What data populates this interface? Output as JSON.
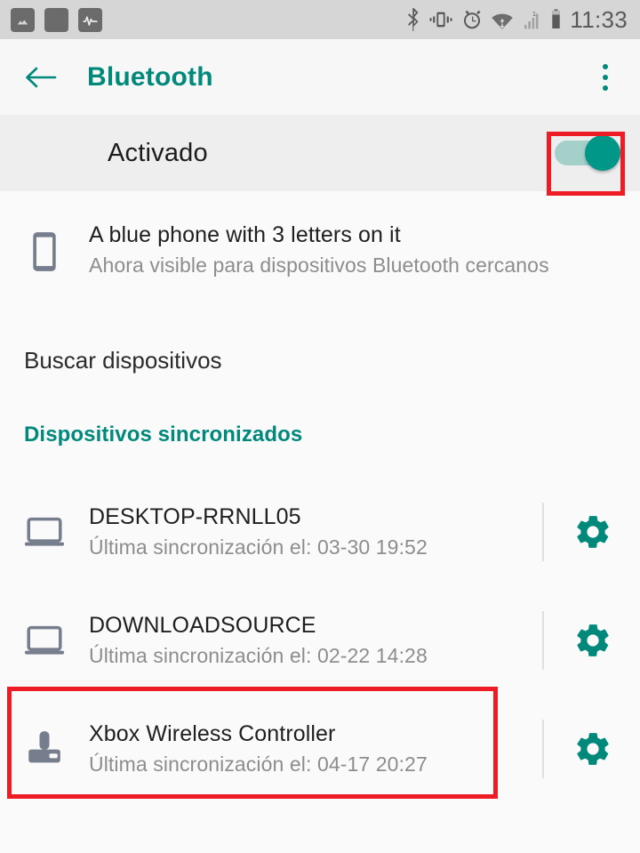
{
  "status_bar": {
    "time": "11:33",
    "notification_icons": [
      "image-icon",
      "blank-square-icon",
      "pulse-icon"
    ],
    "system_icons": [
      "bluetooth-icon",
      "vibrate-icon",
      "alarm-icon",
      "wifi-icon",
      "signal-icon",
      "battery-icon"
    ]
  },
  "app_bar": {
    "title": "Bluetooth",
    "back_icon": "arrow-left-icon",
    "overflow_icon": "more-vertical-icon",
    "accent_color": "#00897b"
  },
  "toggle": {
    "label": "Activado",
    "state": "on",
    "track_color": "#a5cfc9",
    "thumb_color": "#009688",
    "highlight_color": "#ee1c25"
  },
  "self_device": {
    "icon": "phone-icon",
    "name": "A blue phone with 3 letters on it",
    "status": "Ahora visible para dispositivos Bluetooth cercanos"
  },
  "search": {
    "label": "Buscar dispositivos"
  },
  "paired_section": {
    "header": "Dispositivos sincronizados"
  },
  "devices": [
    {
      "icon": "laptop-icon",
      "name": "DESKTOP-RRNLL05",
      "last_sync": "Última sincronización el: 03-30 19:52",
      "settings_icon": "gear-icon",
      "highlighted": false
    },
    {
      "icon": "laptop-icon",
      "name": "DOWNLOADSOURCE",
      "last_sync": "Última sincronización el: 02-22 14:28",
      "settings_icon": "gear-icon",
      "highlighted": false
    },
    {
      "icon": "gamepad-icon",
      "name": "Xbox Wireless Controller",
      "last_sync": "Última sincronización el: 04-17 20:27",
      "settings_icon": "gear-icon",
      "highlighted": true
    }
  ]
}
